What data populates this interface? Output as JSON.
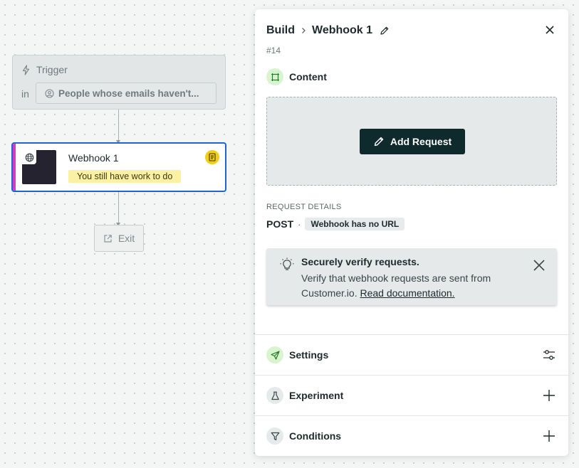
{
  "canvas": {
    "trigger": {
      "label": "Trigger",
      "in_label": "in",
      "segment": "People whose emails haven't...",
      "icon": "lightning-icon",
      "segment_icon": "segment-icon"
    },
    "webhook_node": {
      "title": "Webhook 1",
      "warning": "You still have work to do",
      "icon": "globe-icon",
      "note_icon": "note-icon",
      "accent_color": "#d63cc3",
      "selected_color": "#1a66d6",
      "warning_color": "#fcf0a4"
    },
    "exit": {
      "label": "Exit",
      "icon": "exit-icon"
    }
  },
  "panel": {
    "breadcrumb": [
      "Build",
      "Webhook 1"
    ],
    "node_id": "#14",
    "content": {
      "label": "Content",
      "add_request_label": "Add Request"
    },
    "request_details": {
      "label": "REQUEST DETAILS",
      "method": "POST",
      "separator": "·",
      "url_status": "Webhook has no URL"
    },
    "callout": {
      "title": "Securely verify requests.",
      "body": "Verify that webhook requests are sent from Customer.io.",
      "link": "Read documentation."
    },
    "sections": [
      {
        "label": "Settings",
        "icon": "paper-plane-icon",
        "action_icon": "sliders-icon",
        "icon_bg": "#d9f5cf"
      },
      {
        "label": "Experiment",
        "icon": "flask-icon",
        "action_icon": "plus-icon",
        "icon_bg": "#e6eaea"
      },
      {
        "label": "Conditions",
        "icon": "filter-icon",
        "action_icon": "plus-icon",
        "icon_bg": "#e6eaea"
      }
    ],
    "colors": {
      "primary_button": "#0f2a2d",
      "content_icon_bg": "#d9f5cf"
    }
  }
}
